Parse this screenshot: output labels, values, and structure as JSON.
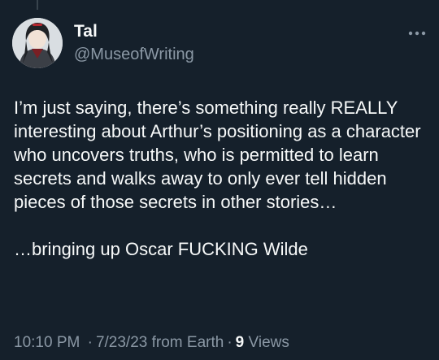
{
  "author": {
    "display_name": "Tal",
    "handle": "@MuseofWriting",
    "avatar_icon": "avatar-portrait"
  },
  "more_icon": "more-horizontal-icon",
  "tweet": {
    "paragraphs": [
      "I’m just saying, there’s something really REALLY interesting about Arthur’s positioning as a character who uncovers truths, who is permitted to learn secrets and walks away to only ever tell hidden pieces of those secrets in other stories…",
      "…bringing up Oscar FUCKING Wilde"
    ]
  },
  "meta": {
    "time": "10:10 PM",
    "separator": "·",
    "date": "7/23/23",
    "source": "from Earth",
    "views_count": "9",
    "views_label": "Views"
  },
  "colors": {
    "background": "#15202b",
    "primary_text": "#f7f9f9",
    "secondary_text": "#8b98a5"
  }
}
